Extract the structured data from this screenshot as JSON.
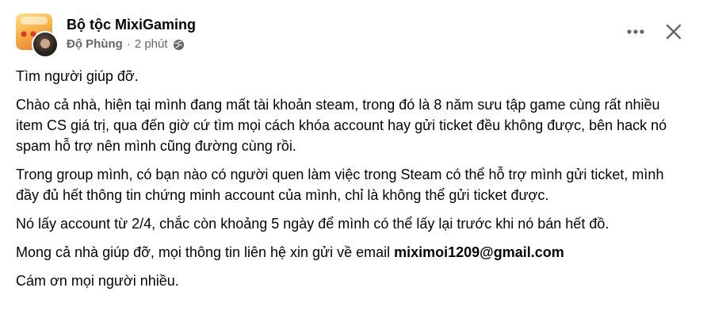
{
  "post": {
    "group_name": "Bộ tộc MixiGaming",
    "author": "Độ Phùng",
    "separator": "·",
    "time_ago": "2 phút",
    "privacy": "public-globe-icon",
    "paragraphs": [
      "Tìm người giúp đỡ.",
      "Chào cả nhà, hiện tại mình đang mất tài khoản steam, trong đó là 8 năm sưu tập game cùng rất nhiều item CS giá trị, qua đến giờ cứ tìm mọi cách khóa account hay gửi ticket đều không được, bên hack nó spam hỗ trợ nên mình cũng đường cùng rồi.",
      "Trong group mình, có bạn nào có người quen làm việc trong Steam có thể hỗ trợ mình gửi ticket, mình đầy đủ hết thông tin chứng minh account của mình, chỉ là không thể gửi ticket được.",
      "Nó lấy account từ 2/4, chắc còn khoảng 5 ngày để mình có thể lấy lại trước khi nó bán hết đồ."
    ],
    "contact_prefix": "Mong cả nhà giúp đỡ, mọi thông tin liên hệ xin gửi về email ",
    "contact_email": "miximoi1209@gmail.com",
    "closing": "Cám ơn mọi người nhiều."
  },
  "actions": {
    "more_icon": "more-horizontal-icon",
    "close_icon": "close-icon"
  },
  "colors": {
    "text_primary": "#050505",
    "text_secondary": "#65676b"
  }
}
